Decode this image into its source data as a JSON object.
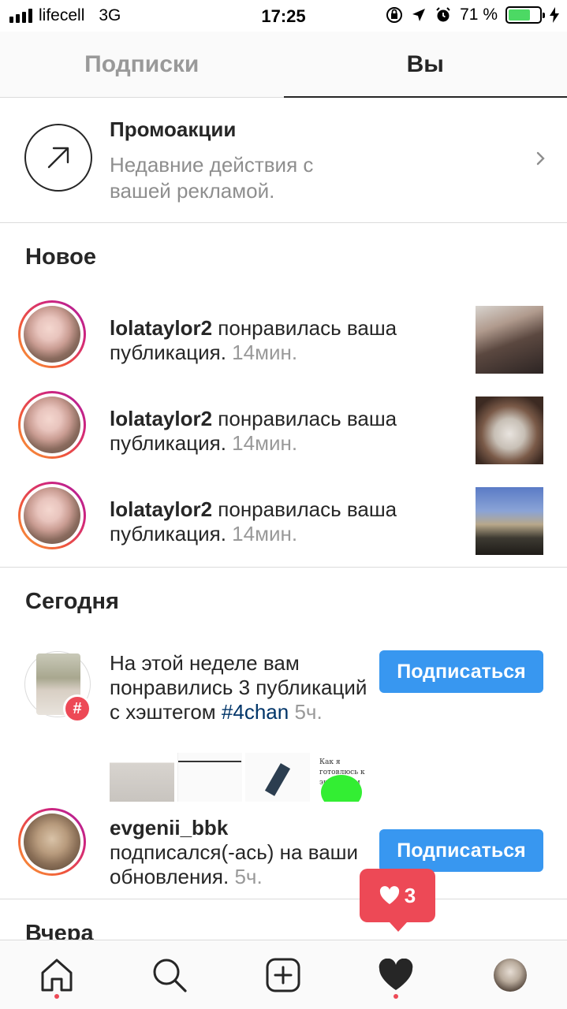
{
  "status_bar": {
    "carrier": "lifecell",
    "network": "3G",
    "time": "17:25",
    "battery": "71 %",
    "battery_level": 0.71
  },
  "tabs": [
    {
      "label": "Подписки",
      "active": false
    },
    {
      "label": "Вы",
      "active": true
    }
  ],
  "promo": {
    "title": "Промоакции",
    "subtitle": "Недавние действия с вашей рекламой."
  },
  "sections": {
    "new": "Новое",
    "today": "Сегодня",
    "yesterday": "Вчера"
  },
  "new_items": [
    {
      "user": "lolataylor2",
      "action": " понравилась ваша публикация.",
      "time": "14мин."
    },
    {
      "user": "lolataylor2",
      "action": " понравилась ваша публикация.",
      "time": "14мин."
    },
    {
      "user": "lolataylor2",
      "action": " понравилась ваша публикация.",
      "time": "14мин."
    }
  ],
  "today_items": [
    {
      "text": "На этой неделе вам понравились 3 публикаций с хэштегом ",
      "hashtag": "#4chan",
      "time": "5ч.",
      "button": "Подписаться",
      "thumb_caption": "Как я готовлюсь к экзаменам"
    },
    {
      "user": "evgenii_bbk",
      "action": "подписался(-ась) на ваши обновления.",
      "time": "5ч.",
      "button": "Подписаться"
    }
  ],
  "heart_popup": {
    "count": "3"
  },
  "colors": {
    "accent": "#3897f0",
    "notification_red": "#ed4956",
    "hashtag": "#003569"
  }
}
